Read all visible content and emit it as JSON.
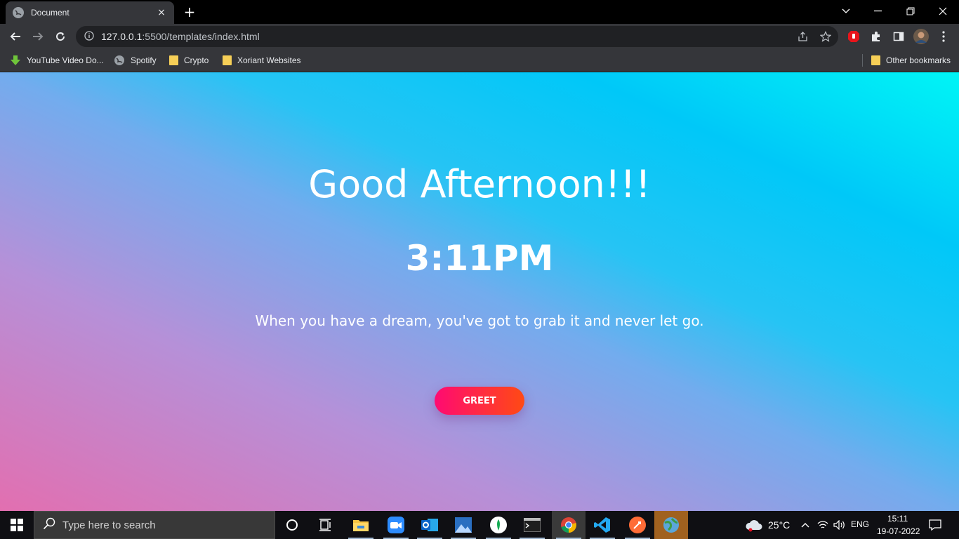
{
  "browser": {
    "tab_title": "Document",
    "tab_close": "×",
    "new_tab": "+",
    "url_host": "127.0.0.1",
    "url_path": ":5500/templates/index.html"
  },
  "bookmarks": [
    {
      "label": "YouTube Video Do...",
      "icon": "download-arrow-icon"
    },
    {
      "label": "Spotify",
      "icon": "globe-icon"
    },
    {
      "label": "Crypto",
      "icon": "folder-icon"
    },
    {
      "label": "Xoriant Websites",
      "icon": "folder-icon"
    }
  ],
  "other_bookmarks": "Other bookmarks",
  "page": {
    "greeting": "Good Afternoon!!!",
    "time": "3:11PM",
    "quote": "When you have a dream, you've got to grab it and never let go.",
    "button": "GREET"
  },
  "taskbar": {
    "search_placeholder": "Type here to search",
    "weather": "25°C",
    "language": "ENG",
    "time": "15:11",
    "date": "19-07-2022"
  },
  "colors": {
    "gradient_bottom_left": "#e26fb0",
    "gradient_top_right": "#00f5f6",
    "button_start": "#ff0a72",
    "button_end": "#ff4a14"
  }
}
